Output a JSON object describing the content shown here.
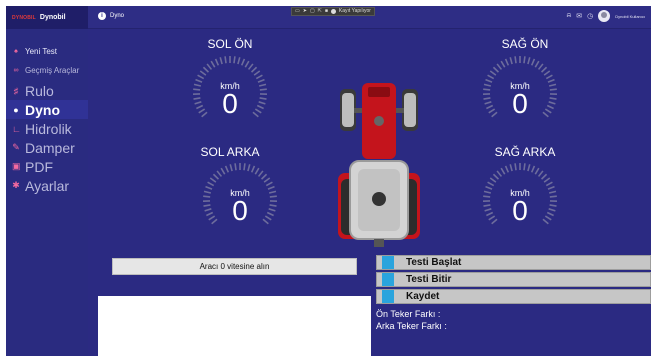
{
  "brand": {
    "logo": "DYNOBIL",
    "name": "Dynobil"
  },
  "page": {
    "indicator": "i",
    "title": "Dyno"
  },
  "window_controls": {
    "record_label": "Kayıt Yapılıyor"
  },
  "header_right": {
    "user": "Dynobil Kullanıcı",
    "icons": [
      "bell-icon",
      "mail-icon",
      "help-icon"
    ]
  },
  "sidebar": {
    "items": [
      {
        "label": "Yeni Test",
        "icon": "home-icon",
        "glyph": "♠"
      },
      {
        "label": "Geçmiş Araçlar",
        "icon": "history-icon",
        "glyph": "∞"
      },
      {
        "label": "Rulo",
        "icon": "roller-icon",
        "glyph": "♯"
      },
      {
        "label": "Dyno",
        "icon": "info-icon",
        "glyph": "●"
      },
      {
        "label": "Hidrolik",
        "icon": "hydraulic-icon",
        "glyph": "∟"
      },
      {
        "label": "Damper",
        "icon": "damper-icon",
        "glyph": "✎"
      },
      {
        "label": "PDF",
        "icon": "pdf-icon",
        "glyph": "▣"
      },
      {
        "label": "Ayarlar",
        "icon": "settings-icon",
        "glyph": "✱"
      }
    ]
  },
  "wheels": {
    "front_left": {
      "label": "SOL ÖN",
      "unit": "km/h",
      "value": "0"
    },
    "front_right": {
      "label": "SAĞ ÖN",
      "unit": "km/h",
      "value": "0"
    },
    "rear_left": {
      "label": "SOL ARKA",
      "unit": "km/h",
      "value": "0"
    },
    "rear_right": {
      "label": "SAĞ ARKA",
      "unit": "km/h",
      "value": "0"
    }
  },
  "message": "Aracı 0 vitesine alın",
  "actions": {
    "start": "Testi Başlat",
    "stop": "Testi Bitir",
    "save": "Kaydet"
  },
  "diffs": {
    "front": "Ön Teker Farkı :",
    "rear": "Arka Teker Farkı :"
  },
  "colors": {
    "background": "#2b2a82",
    "sidebar_icon": "#f56aa0",
    "action_marker": "#2aa4dd"
  }
}
